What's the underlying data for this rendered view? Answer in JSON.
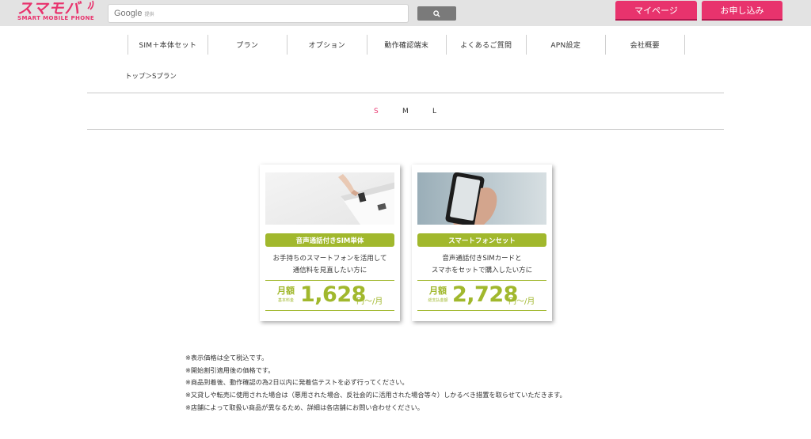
{
  "header": {
    "logo_main": "スマモバ",
    "logo_sub": "SMART MOBILE PHONE",
    "search_google": "Google",
    "search_sub": "提供",
    "mypage_label": "マイページ",
    "apply_label": "お申し込み"
  },
  "nav": {
    "items": [
      "SIM＋本体セット",
      "プラン",
      "オプション",
      "動作確認端末",
      "よくあるご質問",
      "APN設定",
      "会社概要"
    ]
  },
  "breadcrumb": "トップ＞Sプラン",
  "tabs": [
    "S",
    "M",
    "L"
  ],
  "active_tab": "S",
  "cards": [
    {
      "badge": "音声通話付きSIM単体",
      "desc_line1": "お手持ちのスマートフォンを活用して",
      "desc_line2": "通信料を見直したい方に",
      "price_label": "月額",
      "price_sub": "基本料金",
      "price": "1,628",
      "price_unit": "円〜/月"
    },
    {
      "badge": "スマートフォンセット",
      "desc_line1": "音声通話付きSIMカードと",
      "desc_line2": "スマホをセットで購入したい方に",
      "price_label": "月額",
      "price_sub": "総支払金額",
      "price": "2,728",
      "price_unit": "円〜/月"
    }
  ],
  "notes": [
    "※表示価格は全て税込です。",
    "※開始割引適用後の価格です。",
    "※商品到着後、動作確認の為2日以内に発着信テストを必ず行ってください。",
    "※又貸しや転売に使用された場合は（悪用された場合、反社会的に活用された場合等々）しかるべき措置を取らせていただきます。",
    "※店舗によって取扱い商品が異なるため、詳細は各店舗にお問い合わせください。"
  ],
  "colors": {
    "brand": "#e8336d",
    "accent_green": "#a1b82d",
    "search_button": "#7a7a7a"
  }
}
